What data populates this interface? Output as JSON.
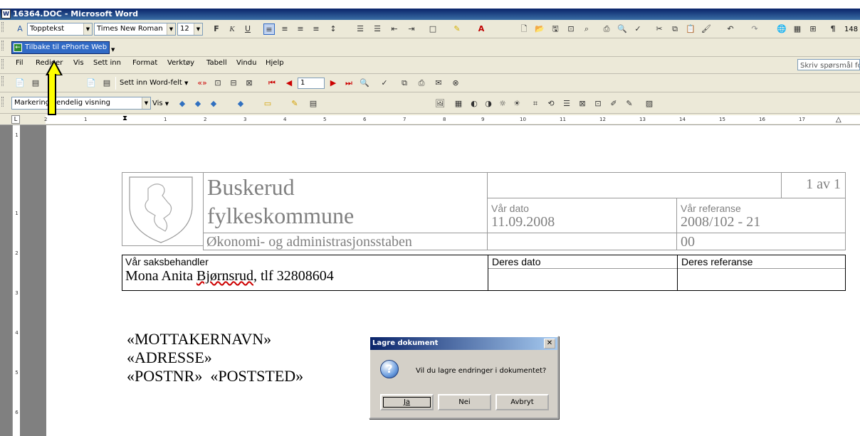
{
  "window": {
    "title": "16364.DOC - Microsoft Word"
  },
  "format_toolbar": {
    "style": "Topptekst",
    "font": "Times New Roman",
    "size": "12",
    "zoom_partial": "148"
  },
  "ephorte_button": {
    "label": "Tilbake til ePhorte Web"
  },
  "menu": {
    "items": [
      "Fil",
      "Rediger",
      "Vis",
      "Sett inn",
      "Format",
      "Verktøy",
      "Tabell",
      "Vindu",
      "Hjelp"
    ],
    "ask_question": "Skriv spørsmål for"
  },
  "mailmerge_toolbar": {
    "insert_word_field": "Sett inn Word-felt",
    "record": "1"
  },
  "review_toolbar": {
    "markup_view": "Markering i endelig visning",
    "show": "Vis"
  },
  "ruler": {
    "ticks": [
      "2",
      "1",
      "1",
      "2",
      "3",
      "4",
      "5",
      "6",
      "7",
      "8",
      "9",
      "10",
      "11",
      "12",
      "13",
      "14",
      "15",
      "16",
      "17"
    ]
  },
  "vruler": {
    "ticks": [
      "1",
      "1",
      "2",
      "3",
      "4",
      "5",
      "6"
    ]
  },
  "document": {
    "org_name_line1": "Buskerud",
    "org_name_line2": "fylkeskommune",
    "org_department": "Økonomi- og administrasjonsstaben",
    "page_number": "1 av 1",
    "our_date_label": "Vår dato",
    "our_date_value": "11.09.2008",
    "our_ref_label": "Vår referanse",
    "our_ref_value": "2008/102 - 21",
    "our_ref_extra": "00",
    "case_handler_label": "Vår saksbehandler",
    "case_handler_value_prefix": "Mona Anita ",
    "case_handler_value_surname": "Bjørnsrud",
    "case_handler_value_suffix": ", tlf 32808604",
    "your_date_label": "Deres dato",
    "your_ref_label": "Deres referanse",
    "recipient_name": "«MOTTAKERNAVN»",
    "address": "«ADRESSE»",
    "postal_code": "«POSTNR»",
    "postal_place": "«POSTSTED»"
  },
  "dialog": {
    "title": "Lagre dokument",
    "message": "Vil du lagre endringer i dokumentet?",
    "yes": "Ja",
    "no": "Nei",
    "cancel": "Avbryt"
  },
  "colors": {
    "titlebar": "#0a246a",
    "toolbar": "#ece9d8",
    "arrow": "#ffff00"
  }
}
